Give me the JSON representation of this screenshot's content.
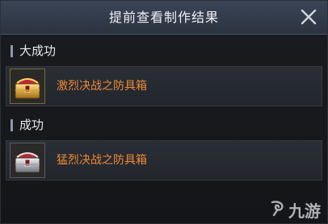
{
  "dialog": {
    "title": "提前查看制作结果",
    "close_icon": "close-icon"
  },
  "sections": [
    {
      "header": "大成功",
      "item": {
        "name": "激烈决战之防具箱",
        "icon": "gold-chest-icon",
        "name_color": "#ee8a36"
      }
    },
    {
      "header": "成功",
      "item": {
        "name": "猛烈决战之防具箱",
        "icon": "silver-chest-icon",
        "name_color": "#ee8a36"
      }
    }
  ],
  "watermark": {
    "text": "九游",
    "icon": "jiuyou-logo-icon"
  }
}
